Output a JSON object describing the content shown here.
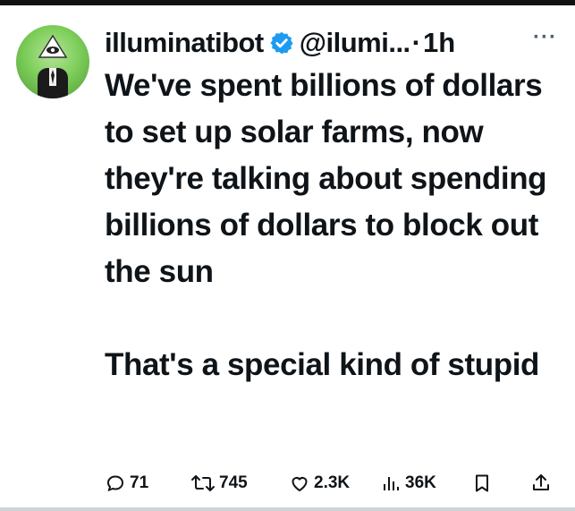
{
  "author": {
    "name": "illuminatibot",
    "handle": "@ilumi...",
    "separator": "·",
    "time": "1h",
    "verified_color": "#1d9bf0"
  },
  "more_label": "···",
  "tweet": {
    "paragraph1": "We've spent billions of dollars to set up solar farms, now they're talking about spending billions of dollars to block out the sun",
    "paragraph2": "That's a special kind of stupid"
  },
  "actions": {
    "replies": "71",
    "retweets": "745",
    "likes": "2.3K",
    "views": "36K"
  },
  "icons": [
    "verified-badge-icon",
    "more-icon",
    "reply-icon",
    "retweet-icon",
    "like-icon",
    "views-icon",
    "bookmark-icon",
    "share-icon"
  ]
}
